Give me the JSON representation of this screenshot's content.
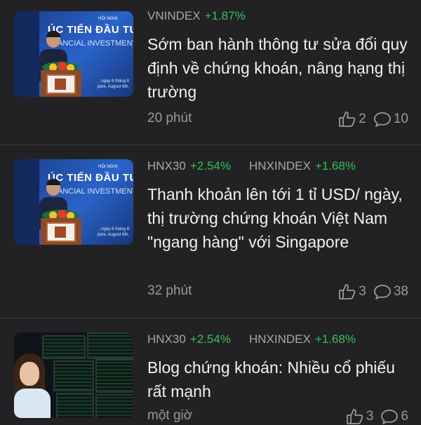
{
  "articles": [
    {
      "tags": [
        {
          "name": "VNINDEX",
          "change": "+1.87%"
        }
      ],
      "headline": "Sớm ban hành thông tư sửa đổi quy định về chứng khoán, nâng hạng thị trường",
      "time": "20 phút",
      "likes": "2",
      "comments": "10",
      "thumb": {
        "title": "ÚC TIẾN ĐẦU TƯ T",
        "subtitle": "ANCIAL INVESTMENT C",
        "hoi": "HỘI NGHỊ",
        "small1": ", ngày 6 tháng 8",
        "small2": "pore, August 6th,"
      }
    },
    {
      "tags": [
        {
          "name": "HNX30",
          "change": "+2.54%"
        },
        {
          "name": "HNXINDEX",
          "change": "+1.68%"
        }
      ],
      "headline": "Thanh khoản lên tới 1 tỉ USD/ ngày, thị trường chứng khoán Việt Nam \"ngang hàng\" với Singapore",
      "time": "32 phút",
      "likes": "3",
      "comments": "38",
      "thumb": {
        "title": "ÚC TIẾN ĐẦU TƯ T",
        "subtitle": "ANCIAL INVESTMENT C",
        "hoi": "HỘI NGHỊ",
        "small1": ", ngày 6 tháng 8",
        "small2": "pore, August 6th,"
      }
    },
    {
      "tags": [
        {
          "name": "HNX30",
          "change": "+2.54%"
        },
        {
          "name": "HNXINDEX",
          "change": "+1.68%"
        }
      ],
      "headline": "Blog chứng khoán: Nhiều cổ phiếu rất mạnh",
      "time": "một giờ",
      "likes": "3",
      "comments": "6"
    }
  ],
  "colors": {
    "background": "#222224",
    "positive": "#35c05a",
    "muted": "#9a9a9a"
  },
  "icons": {
    "like": "thumbs-up-icon",
    "comment": "comment-bubble-icon"
  }
}
